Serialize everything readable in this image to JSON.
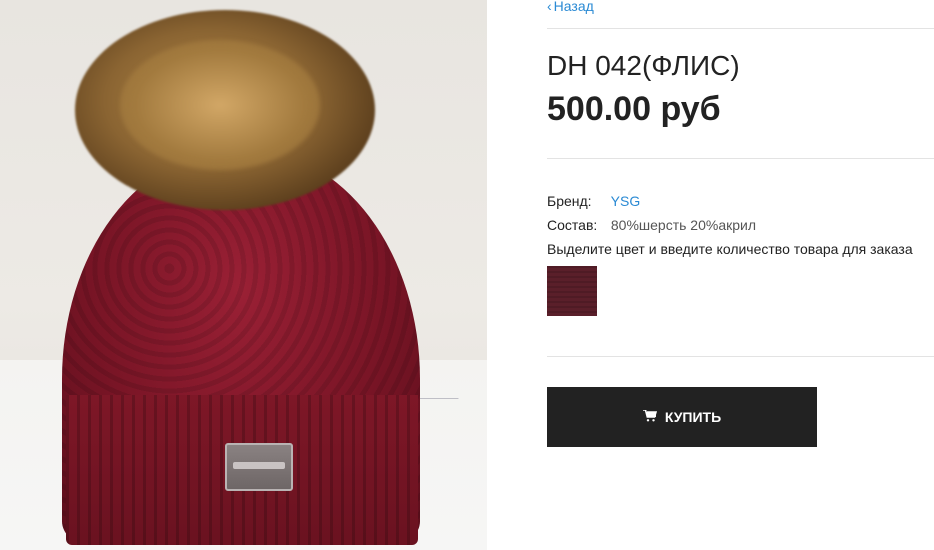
{
  "product_image": {
    "alt": "burgundy knit hat with fur pom-pom",
    "colors": {
      "hat": "#7a1526",
      "pompom": "#a27a3e",
      "background": "#e8e5e0"
    }
  },
  "nav": {
    "back_icon": "‹",
    "back_label": "Назад"
  },
  "product": {
    "title": "DH 042(ФЛИС)",
    "price": "500.00 руб"
  },
  "attributes": {
    "brand_label": "Бренд:",
    "brand_value": "YSG",
    "composition_label": "Состав:",
    "composition_value": "80%шерсть 20%акрил"
  },
  "order_hint": "Выделите цвет и введите количество товара для заказа",
  "swatches": [
    {
      "color": "#5a1f2a"
    }
  ],
  "buy_button": {
    "icon": "cart-icon",
    "label": "КУПИТЬ"
  },
  "theme": {
    "link": "#2a8ad4",
    "button_bg": "#222222"
  }
}
